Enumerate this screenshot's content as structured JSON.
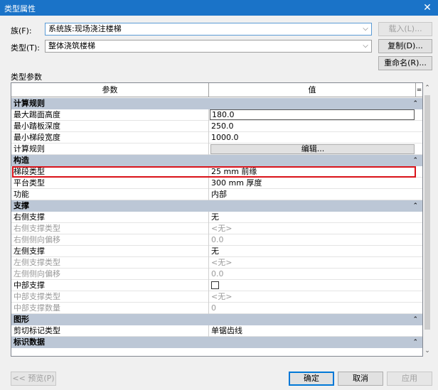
{
  "window": {
    "title": "类型属性",
    "close_glyph": "✕"
  },
  "family": {
    "label": "族(F):",
    "value": "系统族:现场浇注楼梯",
    "load_button": "载入(L)..."
  },
  "type": {
    "label": "类型(T):",
    "value": "整体浇筑楼梯",
    "duplicate_button": "复制(D)...",
    "rename_button": "重命名(R)..."
  },
  "section_label": "类型参数",
  "grid": {
    "col_param": "参数",
    "col_value": "值",
    "col_sort_glyph": "=",
    "groups": [
      {
        "title": "计算规则",
        "rows": [
          {
            "k": "最大踢面高度",
            "v": "180.0",
            "style": "boxed"
          },
          {
            "k": "最小踏板深度",
            "v": "250.0"
          },
          {
            "k": "最小梯段宽度",
            "v": "1000.0"
          },
          {
            "k": "计算规则",
            "v": "编辑...",
            "style": "button"
          }
        ]
      },
      {
        "title": "构造",
        "rows": [
          {
            "k": "梯段类型",
            "v": "25 mm 前缘",
            "highlight": true
          },
          {
            "k": "平台类型",
            "v": "300 mm 厚度"
          },
          {
            "k": "功能",
            "v": "内部"
          }
        ]
      },
      {
        "title": "支撑",
        "rows": [
          {
            "k": "右侧支撑",
            "v": "无"
          },
          {
            "k": "右侧支撑类型",
            "v": "<无>",
            "dim": true
          },
          {
            "k": "右侧侧向偏移",
            "v": "0.0",
            "dim": true
          },
          {
            "k": "左侧支撑",
            "v": "无"
          },
          {
            "k": "左侧支撑类型",
            "v": "<无>",
            "dim": true
          },
          {
            "k": "左侧侧向偏移",
            "v": "0.0",
            "dim": true
          },
          {
            "k": "中部支撑",
            "v": "",
            "style": "checkbox"
          },
          {
            "k": "中部支撑类型",
            "v": "<无>",
            "dim": true
          },
          {
            "k": "中部支撑数量",
            "v": "0",
            "dim": true
          }
        ]
      },
      {
        "title": "图形",
        "rows": [
          {
            "k": "剪切标记类型",
            "v": "单锯齿线"
          }
        ]
      },
      {
        "title": "标识数据",
        "rows": []
      }
    ]
  },
  "footer": {
    "preview_button": "<< 预览(P)",
    "ok_button": "确定",
    "cancel_button": "取消",
    "apply_button": "应用"
  }
}
